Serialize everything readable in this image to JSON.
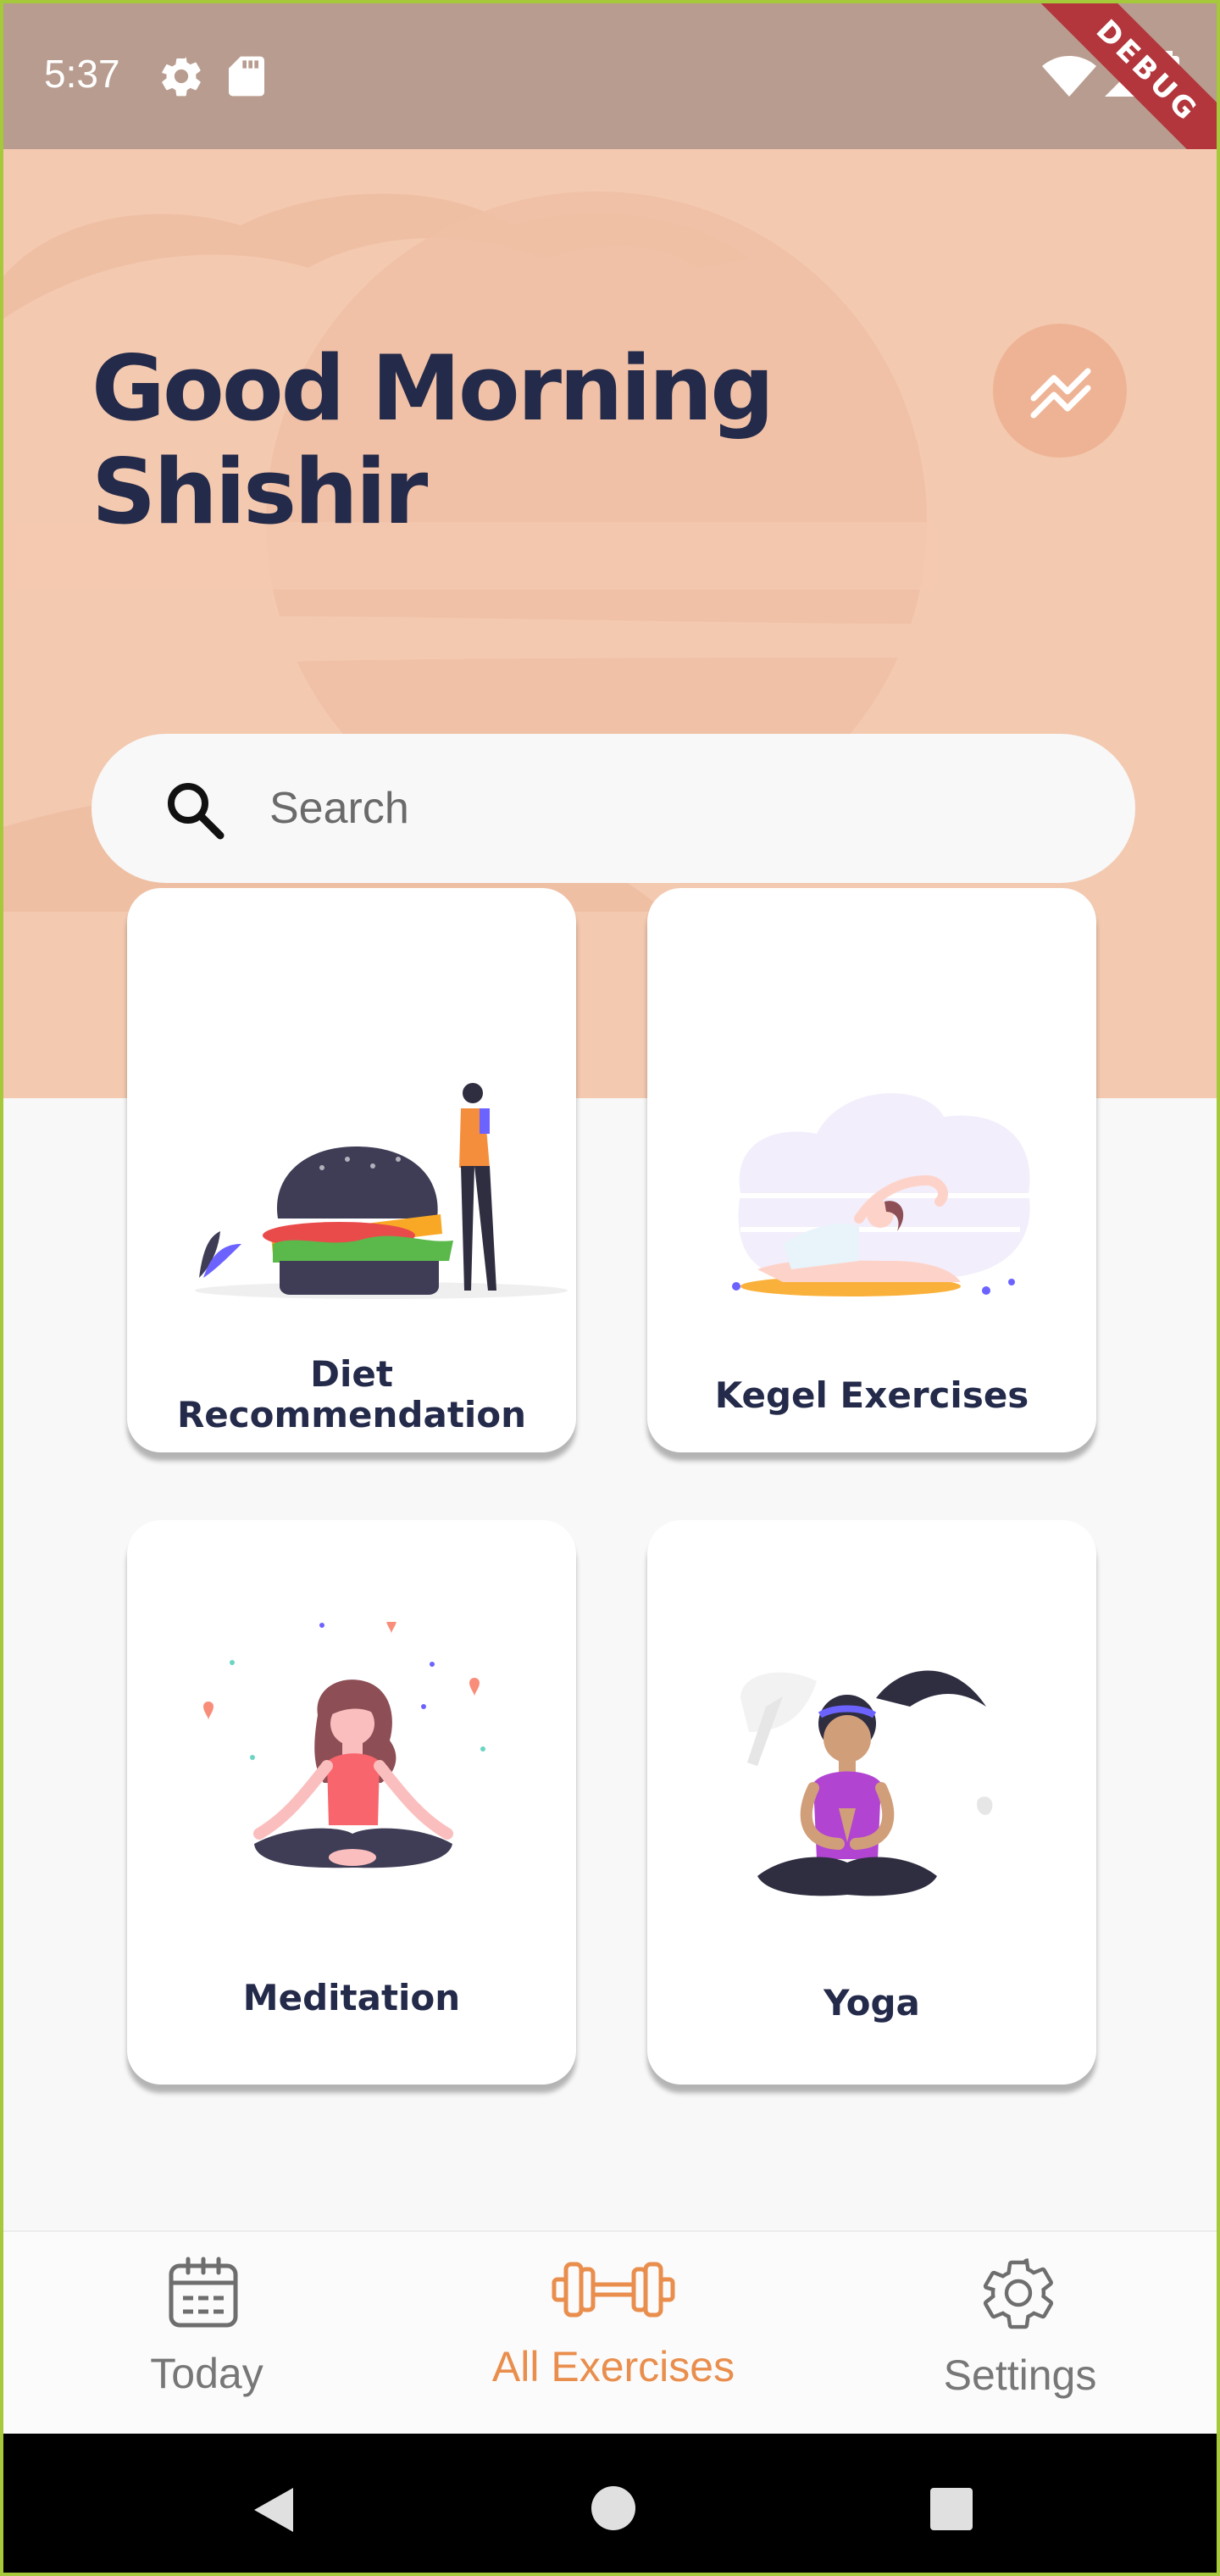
{
  "status_bar": {
    "time": "5:37",
    "debug_label": "DEBUG"
  },
  "header": {
    "greeting_line1": "Good Morning",
    "greeting_line2": "Shishir"
  },
  "search": {
    "placeholder": "Search"
  },
  "cards": [
    {
      "label_line1": "Diet",
      "label_line2": "Recommendation",
      "illustration": "burger-and-person"
    },
    {
      "label_line1": "Kegel Exercises",
      "label_line2": "",
      "illustration": "stretching-woman"
    },
    {
      "label_line1": "Meditation",
      "label_line2": "",
      "illustration": "meditating-woman"
    },
    {
      "label_line1": "Yoga",
      "label_line2": "",
      "illustration": "yoga-woman"
    }
  ],
  "bottom_nav": {
    "items": [
      {
        "label": "Today",
        "icon": "calendar-icon",
        "active": false
      },
      {
        "label": "All Exercises",
        "icon": "dumbbell-icon",
        "active": true
      },
      {
        "label": "Settings",
        "icon": "gear-icon",
        "active": false
      }
    ],
    "active_color": "#E98E4D",
    "inactive_color": "#777777"
  },
  "colors": {
    "hero_background": "#F3C9B0",
    "heading": "#242A4A",
    "status_bar": "#B89C8F"
  }
}
